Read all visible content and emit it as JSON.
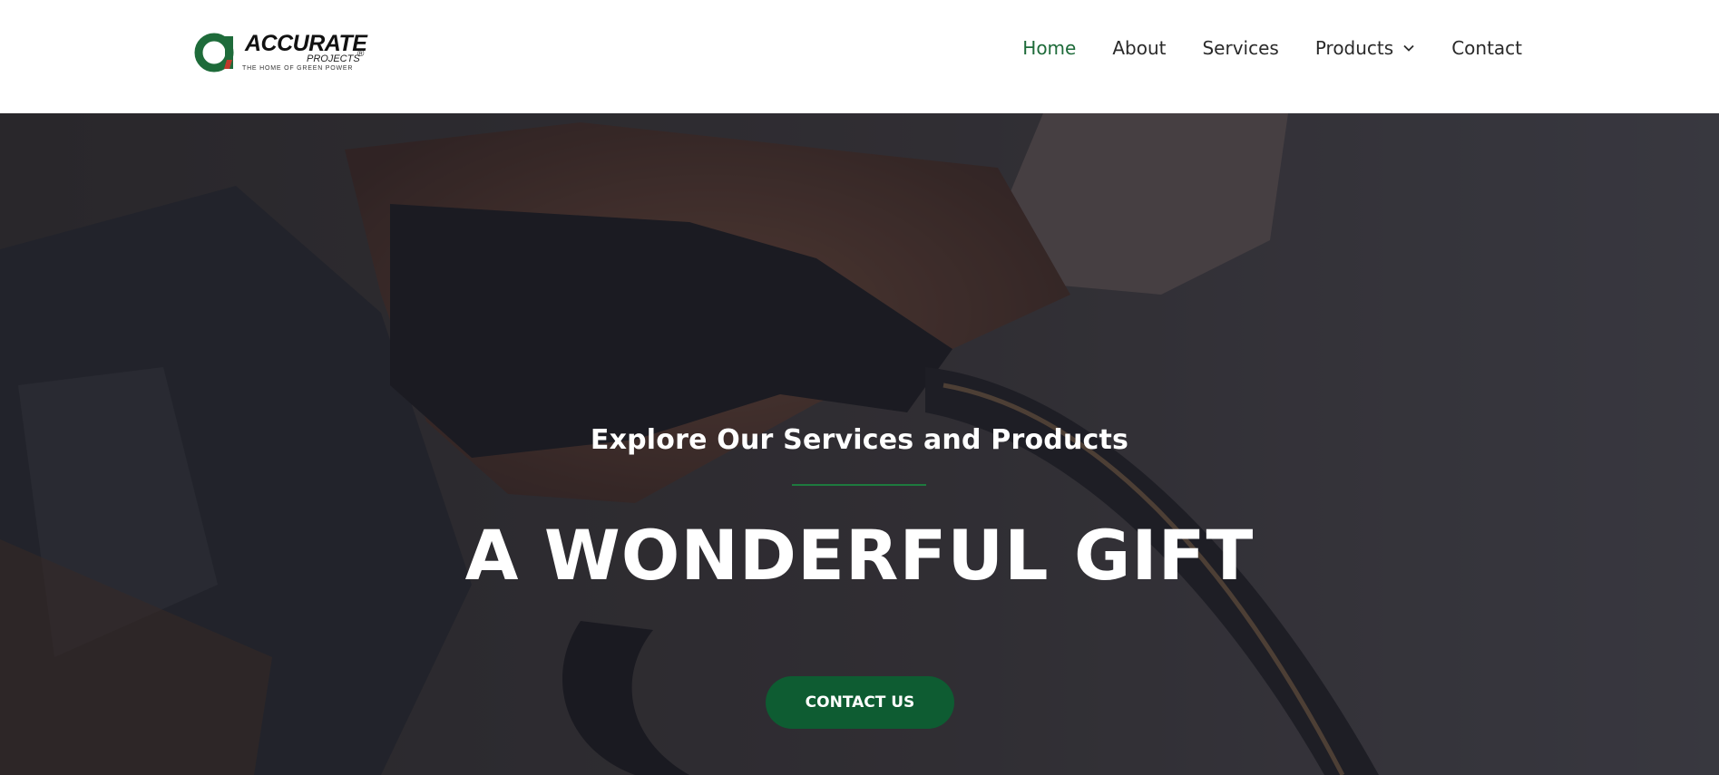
{
  "brand": {
    "logo_text": "ACCURATE",
    "logo_sub": "PROJECTS",
    "logo_registered": "®",
    "logo_tagline": "THE HOME OF GREEN POWER"
  },
  "nav": {
    "items": [
      {
        "label": "Home",
        "active": true
      },
      {
        "label": "About"
      },
      {
        "label": "Services"
      },
      {
        "label": "Products",
        "has_dropdown": true
      },
      {
        "label": "Contact"
      }
    ]
  },
  "hero": {
    "eyebrow": "Explore Our Services and Products",
    "headline": "A WONDERFUL GIFT",
    "cta_label": "CONTACT US",
    "background": "photo of a hand holding an EV charging connector"
  },
  "colors": {
    "accent_green": "#1e6b3a",
    "button_green": "#0e5c32",
    "overlay": "#1c1c22"
  }
}
